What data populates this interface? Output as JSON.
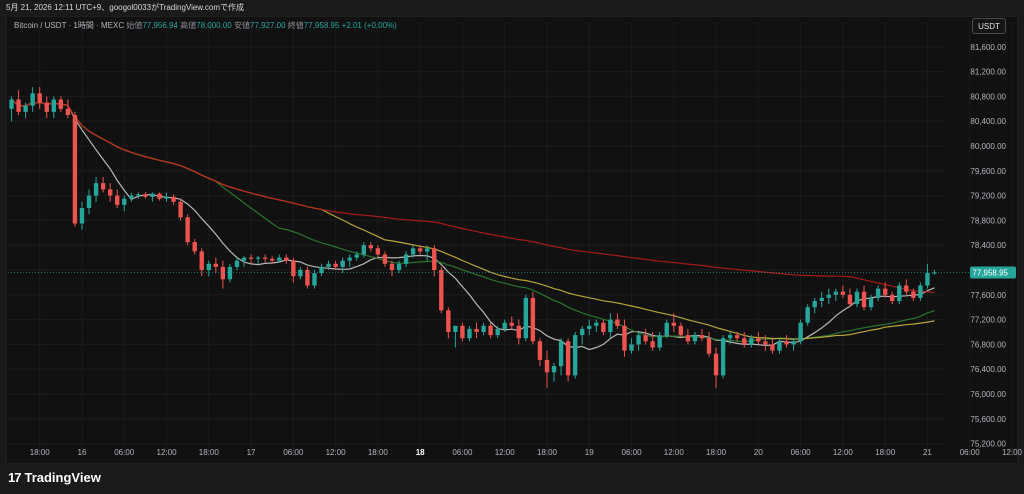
{
  "header": {
    "text": "5月 21, 2026 12:11 UTC+9、googol0033がTradingView.comで作成"
  },
  "legend": {
    "symbol": "Bitcoin / USDT · 1時間 · MEXC",
    "open_label": "始値",
    "open": "77,956.94",
    "high_label": "高値",
    "high": "78,000.00",
    "low_label": "安値",
    "low": "77,927.00",
    "close_label": "終値",
    "close": "77,958.95",
    "change": "+2.01 (+0.00%)"
  },
  "currency_button": "USDT",
  "brand": {
    "name": "TradingView",
    "mark": "17"
  },
  "colors": {
    "up": "#26a69a",
    "down": "#ef5350",
    "ma_fast": "#c9c9c9",
    "ma_mid": "#2e7d32",
    "ma_slow": "#c9b53a",
    "ma_long": "#b71c1c",
    "last_price_bg": "#26a69a"
  },
  "chart_data": {
    "type": "candlestick",
    "title": "Bitcoin / USDT · 1時間 · MEXC",
    "ylim": [
      75000,
      82000
    ],
    "y_ticks": [
      75200,
      75600,
      76000,
      76400,
      76800,
      77200,
      77600,
      78000,
      78400,
      78800,
      79200,
      79600,
      80000,
      80400,
      80800,
      81200,
      81600
    ],
    "y_tick_labels": [
      "75,200.00",
      "75,600.00",
      "76,000.00",
      "76,400.00",
      "76,800.00",
      "77,200.00",
      "77,600.00",
      "78,000.00",
      "78,400.00",
      "78,800.00",
      "79,200.00",
      "79,600.00",
      "80,000.00",
      "80,400.00",
      "80,800.00",
      "81,200.00",
      "81,600.00"
    ],
    "last_price": 77958.95,
    "last_price_label": "77,958.95",
    "x_ticks": [
      {
        "i": 4,
        "label": "18:00",
        "bold": false
      },
      {
        "i": 10,
        "label": "16",
        "bold": false
      },
      {
        "i": 16,
        "label": "06:00",
        "bold": false
      },
      {
        "i": 22,
        "label": "12:00",
        "bold": false
      },
      {
        "i": 28,
        "label": "18:00",
        "bold": false
      },
      {
        "i": 34,
        "label": "17",
        "bold": false
      },
      {
        "i": 40,
        "label": "06:00",
        "bold": false
      },
      {
        "i": 46,
        "label": "12:00",
        "bold": false
      },
      {
        "i": 52,
        "label": "18:00",
        "bold": false
      },
      {
        "i": 58,
        "label": "18",
        "bold": true
      },
      {
        "i": 64,
        "label": "06:00",
        "bold": false
      },
      {
        "i": 70,
        "label": "12:00",
        "bold": false
      },
      {
        "i": 76,
        "label": "18:00",
        "bold": false
      },
      {
        "i": 82,
        "label": "19",
        "bold": false
      },
      {
        "i": 88,
        "label": "06:00",
        "bold": false
      },
      {
        "i": 94,
        "label": "12:00",
        "bold": false
      },
      {
        "i": 100,
        "label": "18:00",
        "bold": false
      },
      {
        "i": 106,
        "label": "20",
        "bold": false
      },
      {
        "i": 112,
        "label": "06:00",
        "bold": false
      },
      {
        "i": 118,
        "label": "12:00",
        "bold": false
      },
      {
        "i": 124,
        "label": "18:00",
        "bold": false
      },
      {
        "i": 130,
        "label": "21",
        "bold": false
      },
      {
        "i": 136,
        "label": "06:00",
        "bold": false
      },
      {
        "i": 142,
        "label": "12:00",
        "bold": false
      }
    ],
    "candles": [
      [
        80600,
        80800,
        80400,
        80750
      ],
      [
        80750,
        80900,
        80500,
        80550
      ],
      [
        80550,
        80700,
        80450,
        80650
      ],
      [
        80650,
        80950,
        80550,
        80850
      ],
      [
        80850,
        80950,
        80600,
        80700
      ],
      [
        80700,
        80800,
        80450,
        80550
      ],
      [
        80550,
        80800,
        80450,
        80750
      ],
      [
        80750,
        80800,
        80550,
        80600
      ],
      [
        80600,
        80750,
        80450,
        80500
      ],
      [
        80500,
        80550,
        78700,
        78750
      ],
      [
        78750,
        79100,
        78650,
        79000
      ],
      [
        79000,
        79300,
        78900,
        79200
      ],
      [
        79200,
        79500,
        79100,
        79400
      ],
      [
        79400,
        79500,
        79250,
        79300
      ],
      [
        79300,
        79400,
        79100,
        79200
      ],
      [
        79200,
        79300,
        79000,
        79050
      ],
      [
        79050,
        79200,
        78950,
        79150
      ],
      [
        79150,
        79250,
        79100,
        79200
      ],
      [
        79200,
        79250,
        79150,
        79220
      ],
      [
        79220,
        79260,
        79150,
        79180
      ],
      [
        79180,
        79250,
        79100,
        79230
      ],
      [
        79230,
        79250,
        79120,
        79150
      ],
      [
        79150,
        79250,
        79100,
        79180
      ],
      [
        79180,
        79220,
        79050,
        79100
      ],
      [
        79100,
        79150,
        78800,
        78850
      ],
      [
        78850,
        78900,
        78400,
        78450
      ],
      [
        78450,
        78500,
        78250,
        78300
      ],
      [
        78300,
        78350,
        77900,
        78000
      ],
      [
        78000,
        78150,
        77900,
        78100
      ],
      [
        78100,
        78200,
        77950,
        78050
      ],
      [
        78050,
        78150,
        77700,
        77850
      ],
      [
        77850,
        78100,
        77800,
        78050
      ],
      [
        78050,
        78200,
        78000,
        78150
      ],
      [
        78150,
        78220,
        78050,
        78200
      ],
      [
        78200,
        78250,
        78100,
        78180
      ],
      [
        78180,
        78230,
        78100,
        78200
      ],
      [
        78200,
        78250,
        78120,
        78180
      ],
      [
        78180,
        78220,
        78100,
        78150
      ],
      [
        78150,
        78250,
        78120,
        78200
      ],
      [
        78200,
        78250,
        78100,
        78150
      ],
      [
        78150,
        78200,
        77800,
        77900
      ],
      [
        77900,
        78050,
        77850,
        78000
      ],
      [
        78000,
        78050,
        77700,
        77750
      ],
      [
        77750,
        78000,
        77700,
        77950
      ],
      [
        77950,
        78100,
        77900,
        78050
      ],
      [
        78050,
        78150,
        78000,
        78100
      ],
      [
        78100,
        78150,
        78000,
        78050
      ],
      [
        78050,
        78200,
        77950,
        78150
      ],
      [
        78150,
        78250,
        78050,
        78200
      ],
      [
        78200,
        78300,
        78150,
        78250
      ],
      [
        78250,
        78450,
        78200,
        78400
      ],
      [
        78400,
        78450,
        78300,
        78350
      ],
      [
        78350,
        78400,
        78200,
        78250
      ],
      [
        78250,
        78300,
        78050,
        78100
      ],
      [
        78100,
        78150,
        77900,
        78000
      ],
      [
        78000,
        78150,
        77950,
        78100
      ],
      [
        78100,
        78300,
        78050,
        78250
      ],
      [
        78250,
        78400,
        78200,
        78350
      ],
      [
        78350,
        78400,
        78250,
        78300
      ],
      [
        78300,
        78400,
        78150,
        78350
      ],
      [
        78350,
        78400,
        77900,
        78000
      ],
      [
        78000,
        78050,
        77300,
        77350
      ],
      [
        77350,
        77400,
        76900,
        77000
      ],
      [
        77000,
        77100,
        76750,
        77100
      ],
      [
        77100,
        77150,
        76850,
        76900
      ],
      [
        76900,
        77100,
        76850,
        77050
      ],
      [
        77050,
        77150,
        76900,
        77000
      ],
      [
        77000,
        77150,
        76950,
        77100
      ],
      [
        77100,
        77150,
        76900,
        76950
      ],
      [
        76950,
        77100,
        76900,
        77050
      ],
      [
        77050,
        77200,
        77000,
        77150
      ],
      [
        77150,
        77250,
        77050,
        77100
      ],
      [
        77100,
        77200,
        76800,
        76900
      ],
      [
        76900,
        77600,
        76850,
        77550
      ],
      [
        77550,
        77650,
        76800,
        76850
      ],
      [
        76850,
        76900,
        76450,
        76550
      ],
      [
        76550,
        76700,
        76100,
        76350
      ],
      [
        76350,
        76500,
        76200,
        76450
      ],
      [
        76450,
        76900,
        76300,
        76850
      ],
      [
        76850,
        76900,
        76200,
        76300
      ],
      [
        76300,
        77000,
        76250,
        76950
      ],
      [
        76950,
        77100,
        76800,
        77050
      ],
      [
        77050,
        77200,
        76950,
        77100
      ],
      [
        77100,
        77200,
        77000,
        77150
      ],
      [
        77150,
        77200,
        76950,
        77000
      ],
      [
        77000,
        77300,
        76900,
        77200
      ],
      [
        77200,
        77300,
        77050,
        77100
      ],
      [
        77100,
        77200,
        76600,
        76700
      ],
      [
        76700,
        76900,
        76650,
        76800
      ],
      [
        76800,
        77000,
        76700,
        76950
      ],
      [
        76950,
        77050,
        76800,
        76850
      ],
      [
        76850,
        77000,
        76700,
        76750
      ],
      [
        76750,
        77000,
        76700,
        76950
      ],
      [
        76950,
        77200,
        76900,
        77150
      ],
      [
        77150,
        77300,
        77000,
        77100
      ],
      [
        77100,
        77150,
        76900,
        76950
      ],
      [
        76950,
        77050,
        76800,
        76850
      ],
      [
        76850,
        77000,
        76800,
        76950
      ],
      [
        76950,
        77050,
        76850,
        76900
      ],
      [
        76900,
        77000,
        76600,
        76650
      ],
      [
        76650,
        76750,
        76100,
        76300
      ],
      [
        76300,
        76950,
        76250,
        76900
      ],
      [
        76900,
        77000,
        76800,
        76950
      ],
      [
        76950,
        77000,
        76850,
        76900
      ],
      [
        76900,
        77000,
        76750,
        76800
      ],
      [
        76800,
        76950,
        76750,
        76900
      ],
      [
        76900,
        77000,
        76800,
        76850
      ],
      [
        76850,
        76950,
        76700,
        76800
      ],
      [
        76800,
        76900,
        76650,
        76700
      ],
      [
        76700,
        76900,
        76650,
        76850
      ],
      [
        76850,
        76950,
        76750,
        76800
      ],
      [
        76800,
        76900,
        76700,
        76850
      ],
      [
        76850,
        77200,
        76800,
        77150
      ],
      [
        77150,
        77450,
        77100,
        77400
      ],
      [
        77400,
        77550,
        77300,
        77500
      ],
      [
        77500,
        77650,
        77400,
        77550
      ],
      [
        77550,
        77700,
        77450,
        77600
      ],
      [
        77600,
        77700,
        77500,
        77650
      ],
      [
        77650,
        77750,
        77550,
        77600
      ],
      [
        77600,
        77700,
        77400,
        77450
      ],
      [
        77450,
        77700,
        77400,
        77650
      ],
      [
        77650,
        77750,
        77350,
        77400
      ],
      [
        77400,
        77600,
        77350,
        77550
      ],
      [
        77550,
        77750,
        77500,
        77700
      ],
      [
        77700,
        77800,
        77550,
        77600
      ],
      [
        77600,
        77650,
        77450,
        77500
      ],
      [
        77500,
        77800,
        77450,
        77750
      ],
      [
        77750,
        77850,
        77600,
        77650
      ],
      [
        77650,
        77700,
        77500,
        77550
      ],
      [
        77550,
        77800,
        77500,
        77750
      ],
      [
        77750,
        78100,
        77700,
        77950
      ],
      [
        77950,
        78000,
        77927,
        77959
      ]
    ]
  }
}
